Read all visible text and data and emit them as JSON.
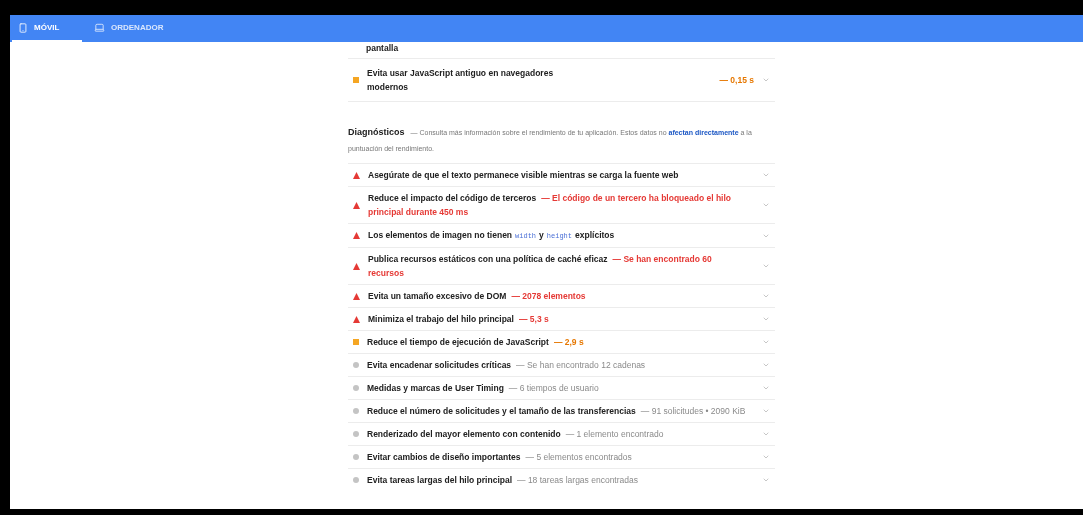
{
  "tabs": [
    {
      "label": "MÓVIL",
      "selected": true
    },
    {
      "label": "ORDENADOR",
      "selected": false
    }
  ],
  "previous_audit_tail": "pantalla",
  "opportunities": [
    {
      "kind": "average",
      "title": "Evita usar JavaScript antiguo en navegadores modernos",
      "value": "— 0,15 s"
    }
  ],
  "diagnostics": {
    "heading": "Diagnósticos",
    "description_before": "— Consulta más información sobre el rendimiento de tu aplicación. Estos datos no",
    "link": "afectan directamente",
    "description_after": "a la puntuación del rendimiento.",
    "audits": [
      {
        "kind": "fail",
        "title": "Asegúrate de que el texto permanece visible mientras se carga la fuente web"
      },
      {
        "kind": "fail",
        "title": "Reduce el impacto del código de terceros",
        "detail": "— El código de un tercero ha bloqueado el hilo principal durante 450 ms"
      },
      {
        "kind": "fail",
        "title_parts": [
          {
            "text": "Los elementos de imagen no tienen",
            "code": false
          },
          {
            "text": "width",
            "code": true
          },
          {
            "text": "y",
            "code": false
          },
          {
            "text": "height",
            "code": true
          },
          {
            "text": "explícitos",
            "code": false
          }
        ]
      },
      {
        "kind": "fail",
        "title": "Publica recursos estáticos con una política de caché eficaz",
        "detail": "— Se han encontrado 60 recursos"
      },
      {
        "kind": "fail",
        "title": "Evita un tamaño excesivo de DOM",
        "detail": "— 2078 elementos"
      },
      {
        "kind": "fail",
        "title": "Minimiza el trabajo del hilo principal",
        "detail": "— 5,3 s"
      },
      {
        "kind": "average",
        "title": "Reduce el tiempo de ejecución de JavaScript",
        "detail": "— 2,9 s"
      },
      {
        "kind": "info",
        "title": "Evita encadenar solicitudes críticas",
        "detail": "— Se han encontrado 12 cadenas"
      },
      {
        "kind": "info",
        "title": "Medidas y marcas de User Timing",
        "detail": "— 6 tiempos de usuario"
      },
      {
        "kind": "info",
        "title": "Reduce el número de solicitudes y el tamaño de las transferencias",
        "detail": "— 91 solicitudes • 2090 KiB"
      },
      {
        "kind": "info",
        "title": "Renderizado del mayor elemento con contenido",
        "detail": "— 1 elemento encontrado"
      },
      {
        "kind": "info",
        "title": "Evitar cambios de diseño importantes",
        "detail": "— 5 elementos encontrados"
      },
      {
        "kind": "info",
        "title": "Evita tareas largas del hilo principal",
        "detail": "— 18 tareas largas encontradas"
      }
    ]
  }
}
